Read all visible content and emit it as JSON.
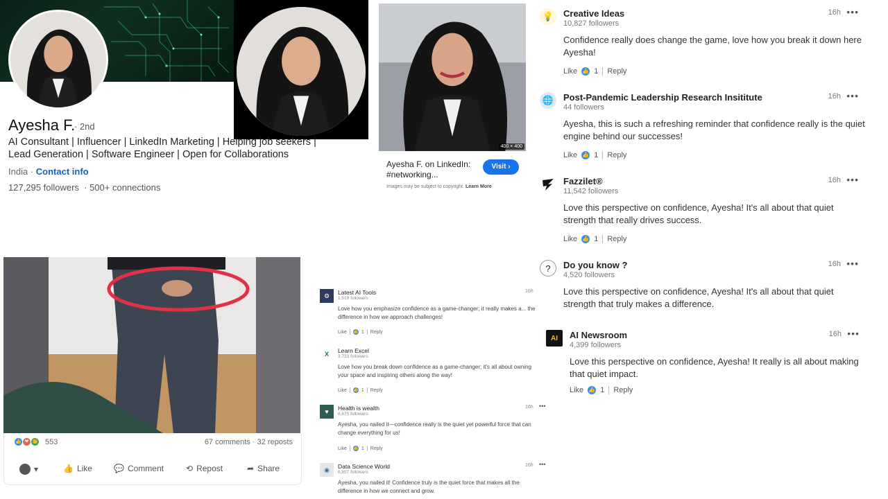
{
  "profile": {
    "name": "Ayesha F.",
    "degree": "· 2nd",
    "headline": "AI Consultant | Influencer | LinkedIn Marketing | Helping job seekers | Lead Generation | Software Engineer | Open for Collaborations",
    "location": "India ·",
    "contact_link": "Contact info",
    "followers": "127,295 followers",
    "connections": "· 500+ connections"
  },
  "image_result": {
    "size_badge": "400 × 400",
    "title": "Ayesha F. on LinkedIn: #networking...",
    "visit_label": "Visit",
    "visit_chevron": "›",
    "note": "Images may be subject to copyright.",
    "learn_more": "Learn More"
  },
  "comments_right": [
    {
      "author": "Creative Ideas",
      "followers": "10,827 followers",
      "time": "16h",
      "text": "Confidence really does change the game, love how you break it down here Ayesha!",
      "like_label": "Like",
      "like_count": "1",
      "reply_label": "Reply",
      "logo_icon": "lightbulb-icon"
    },
    {
      "author": "Post-Pandemic Leadership Research Insititute",
      "followers": "44 followers",
      "time": "16h",
      "text": "Ayesha, this is such a refreshing reminder that confidence really is the quiet engine behind our successes!",
      "like_label": "Like",
      "like_count": "1",
      "reply_label": "Reply",
      "logo_icon": "globe-icon"
    },
    {
      "author": "Fazzilet®",
      "followers": "11,542 followers",
      "time": "16h",
      "text": "Love this perspective on confidence, Ayesha! It's all about that quiet strength that really drives success.",
      "like_label": "Like",
      "like_count": "1",
      "reply_label": "Reply",
      "logo_icon": "brand-mark-icon"
    },
    {
      "author": "Do you know ?",
      "followers": "4,520 followers",
      "time": "16h",
      "text": "Love this perspective on confidence, Ayesha! It's all about that quiet strength that truly makes a difference.",
      "like_label": "",
      "like_count": "",
      "reply_label": "",
      "logo_icon": "question-face-icon"
    },
    {
      "author": "AI Newsroom",
      "followers": "4,399 followers",
      "time": "16h",
      "text": "Love this perspective on confidence, Ayesha! It really is all about making that quiet impact.",
      "like_label": "Like",
      "like_count": "1",
      "reply_label": "Reply",
      "logo_icon": "ai-chip-icon"
    }
  ],
  "post": {
    "reaction_count": "553",
    "comments": "67 comments",
    "reposts": "· 32 reposts",
    "actions": {
      "like": "Like",
      "comment": "Comment",
      "repost": "Repost",
      "share": "Share"
    }
  },
  "comments_small": [
    {
      "author": "Latest AI Tools",
      "followers": "1,519 followers",
      "time": "16h",
      "text": "Love how you emphasize confidence as a game-changer; it really makes a... the difference in how we approach challenges!",
      "like_label": "Like",
      "like_count": "1",
      "reply_label": "Reply"
    },
    {
      "author": "Learn Excel",
      "followers": "3,733 followers",
      "time": "",
      "text": "Love how you break down confidence as a game-changer; it's all about owning your space and inspiring others along the way!",
      "like_label": "Like",
      "like_count": "1",
      "reply_label": "Reply"
    },
    {
      "author": "Health is wealth",
      "followers": "6,675 followers",
      "time": "16h",
      "text": "Ayesha, you nailed it—confidence really is the quiet yet powerful force that can change everything for us!",
      "like_label": "Like",
      "like_count": "1",
      "reply_label": "Reply"
    },
    {
      "author": "Data Science World",
      "followers": "6,857 followers",
      "time": "16h",
      "text": "Ayesha, you nailed it! Confidence truly is the quiet force that makes all the difference in how we connect and grow.",
      "like_label": "",
      "like_count": "",
      "reply_label": ""
    }
  ],
  "colors": {
    "link": "#0a66c2",
    "visit": "#1a73e8",
    "like": "#378fe9"
  }
}
